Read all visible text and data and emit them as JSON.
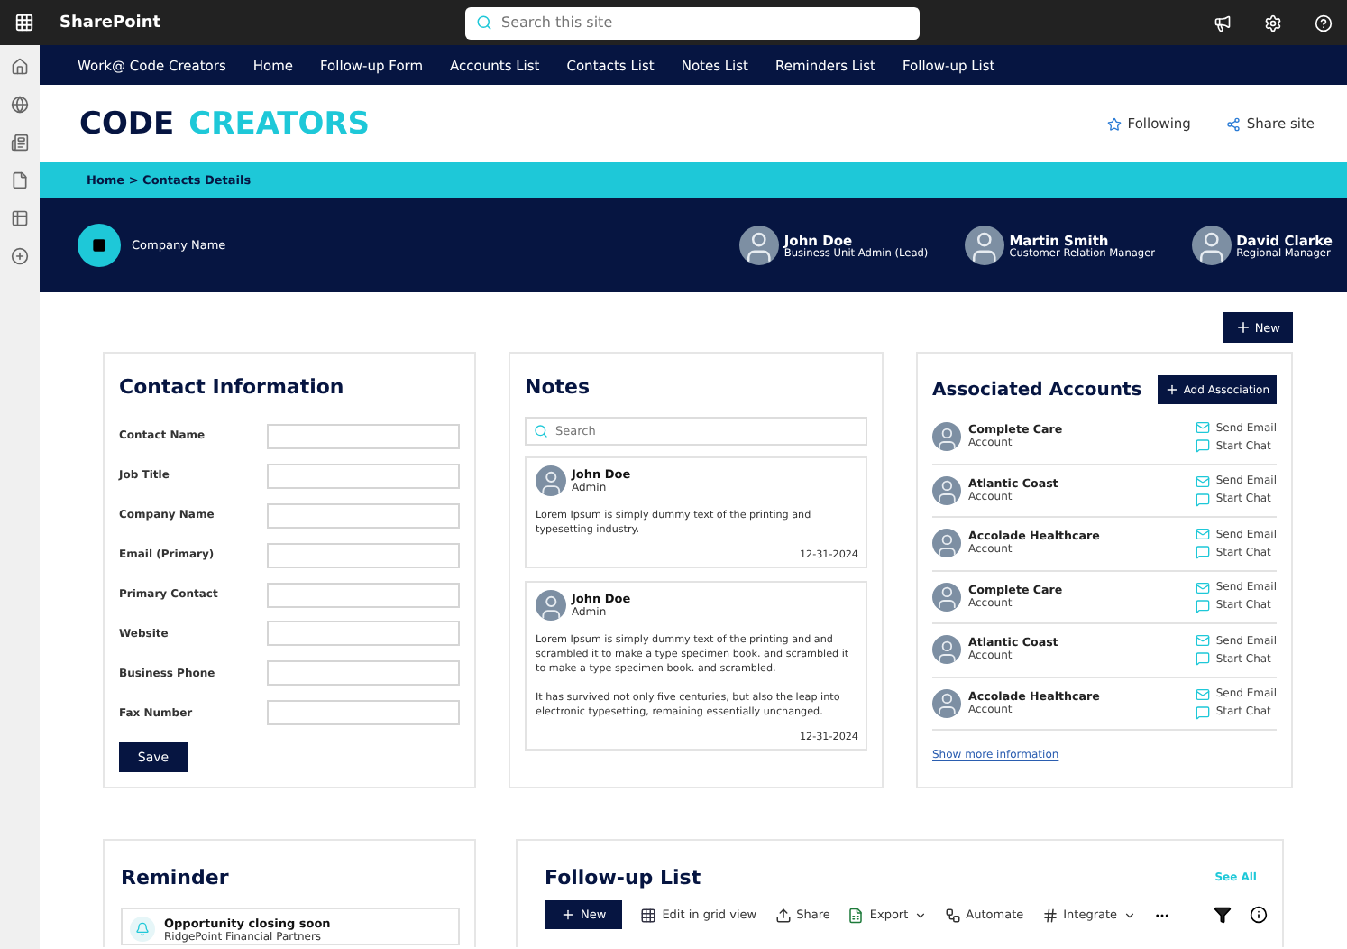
{
  "app": {
    "name": "SharePoint",
    "search_placeholder": "Search this site"
  },
  "nav": [
    "Work@ Code Creators",
    "Home",
    "Follow-up Form",
    "Accounts List",
    "Contacts List",
    "Notes List",
    "Reminders List",
    "Follow-up List"
  ],
  "site": {
    "logo_first": "CODE",
    "logo_second": "CREATORS",
    "following": "Following",
    "share": "Share site"
  },
  "breadcrumb": "Home > Contacts Details",
  "banner": {
    "company": "Company Name",
    "people": [
      {
        "name": "John Doe",
        "role": "Business Unit Admin (Lead)"
      },
      {
        "name": "Martin Smith",
        "role": "Customer Relation Manager"
      },
      {
        "name": "David Clarke",
        "role": "Regional Manager"
      }
    ]
  },
  "new_button": "New",
  "contact": {
    "title": "Contact Information",
    "fields": [
      "Contact Name",
      "Job Title",
      "Company Name",
      "Email (Primary)",
      "Primary Contact",
      "Website",
      "Business Phone",
      "Fax Number"
    ],
    "save": "Save"
  },
  "notes": {
    "title": "Notes",
    "search_placeholder": "Search",
    "items": [
      {
        "name": "John Doe",
        "role": "Admin",
        "paragraphs": [
          "Lorem Ipsum is simply dummy text of the printing and typesetting industry."
        ],
        "date": "12-31-2024"
      },
      {
        "name": "John Doe",
        "role": "Admin",
        "paragraphs": [
          "Lorem Ipsum is simply dummy text of the printing and and scrambled it to make a type specimen book. and scrambled it to make a type specimen book. and scrambled.",
          "It has survived not only five centuries, but also the leap into electronic typesetting, remaining essentially unchanged."
        ],
        "date": "12-31-2024"
      }
    ]
  },
  "accounts": {
    "title": "Associated Accounts",
    "add": "Add Association",
    "more": "Show more information",
    "items": [
      {
        "name": "Complete Care",
        "type": "Account",
        "email": "Send Email",
        "chat": "Start Chat"
      },
      {
        "name": "Atlantic Coast",
        "type": "Account",
        "email": "Send Email",
        "chat": "Start Chat"
      },
      {
        "name": "Accolade Healthcare",
        "type": "Account",
        "email": "Send Email",
        "chat": "Start Chat"
      },
      {
        "name": "Complete Care",
        "type": "Account",
        "email": "Send Email",
        "chat": "Start Chat"
      },
      {
        "name": "Atlantic Coast",
        "type": "Account",
        "email": "Send Email",
        "chat": "Start Chat"
      },
      {
        "name": "Accolade Healthcare",
        "type": "Account",
        "email": "Send Email",
        "chat": "Start Chat"
      }
    ]
  },
  "reminder": {
    "title": "Reminder",
    "items": [
      {
        "title": "Opportunity closing soon",
        "subtitle": "RidgePoint Financial Partners"
      }
    ]
  },
  "followup": {
    "title": "Follow-up List",
    "see_all": "See All",
    "toolbar": [
      {
        "kind": "new",
        "label": "New"
      },
      {
        "kind": "grid",
        "label": "Edit in grid view"
      },
      {
        "kind": "share",
        "label": "Share"
      },
      {
        "kind": "export",
        "label": "Export"
      },
      {
        "kind": "automate",
        "label": "Automate"
      },
      {
        "kind": "integrate",
        "label": "Integrate"
      }
    ]
  }
}
